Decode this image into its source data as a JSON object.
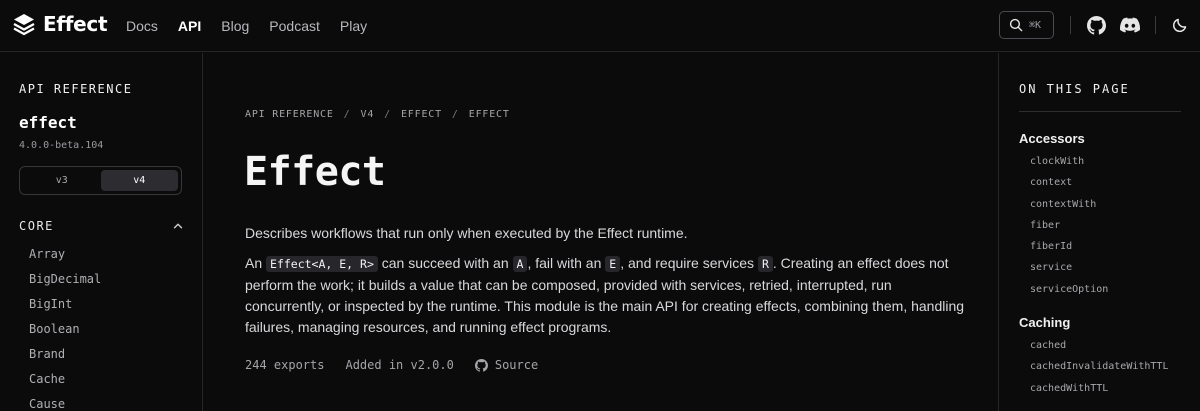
{
  "brand": {
    "name": "Effect"
  },
  "nav": {
    "links": [
      "Docs",
      "API",
      "Blog",
      "Podcast",
      "Play"
    ],
    "active": "API"
  },
  "search": {
    "shortcut": "⌘K"
  },
  "header_icons": [
    "github-icon",
    "discord-icon",
    "theme-toggle-icon"
  ],
  "sidebar": {
    "heading": "API REFERENCE",
    "package": "effect",
    "version": "4.0.0-beta.104",
    "versions": [
      "v3",
      "v4"
    ],
    "selected_version": "v4",
    "section": "CORE",
    "modules": [
      "Array",
      "BigDecimal",
      "BigInt",
      "Boolean",
      "Brand",
      "Cache",
      "Cause"
    ]
  },
  "main": {
    "breadcrumb": [
      "API REFERENCE",
      "V4",
      "EFFECT",
      "EFFECT"
    ],
    "title": "Effect",
    "description": "Describes workflows that run only when executed by the Effect runtime.",
    "para": {
      "t1": "An ",
      "c1": "Effect<A, E, R>",
      "t2": " can succeed with an ",
      "c2": "A",
      "t3": ", fail with an ",
      "c3": "E",
      "t4": ", and require services ",
      "c4": "R",
      "t5": ". Creating an effect does not perform the work; it builds a value that can be composed, provided with services, retried, interrupted, run concurrently, or inspected by the runtime. This module is the main API for creating effects, combining them, handling failures, managing resources, and running effect programs."
    },
    "exports": "244 exports",
    "added": "Added in v2.0.0",
    "source": "Source"
  },
  "toc": {
    "heading": "ON THIS PAGE",
    "groups": [
      {
        "title": "Accessors",
        "items": [
          "clockWith",
          "context",
          "contextWith",
          "fiber",
          "fiberId",
          "service",
          "serviceOption"
        ]
      },
      {
        "title": "Caching",
        "items": [
          "cached",
          "cachedInvalidateWithTTL",
          "cachedWithTTL"
        ]
      }
    ]
  },
  "colors": {
    "background": "#0b0b0c",
    "border": "#26262a",
    "text": "#e6e6e6",
    "muted": "#a8a8ac"
  }
}
